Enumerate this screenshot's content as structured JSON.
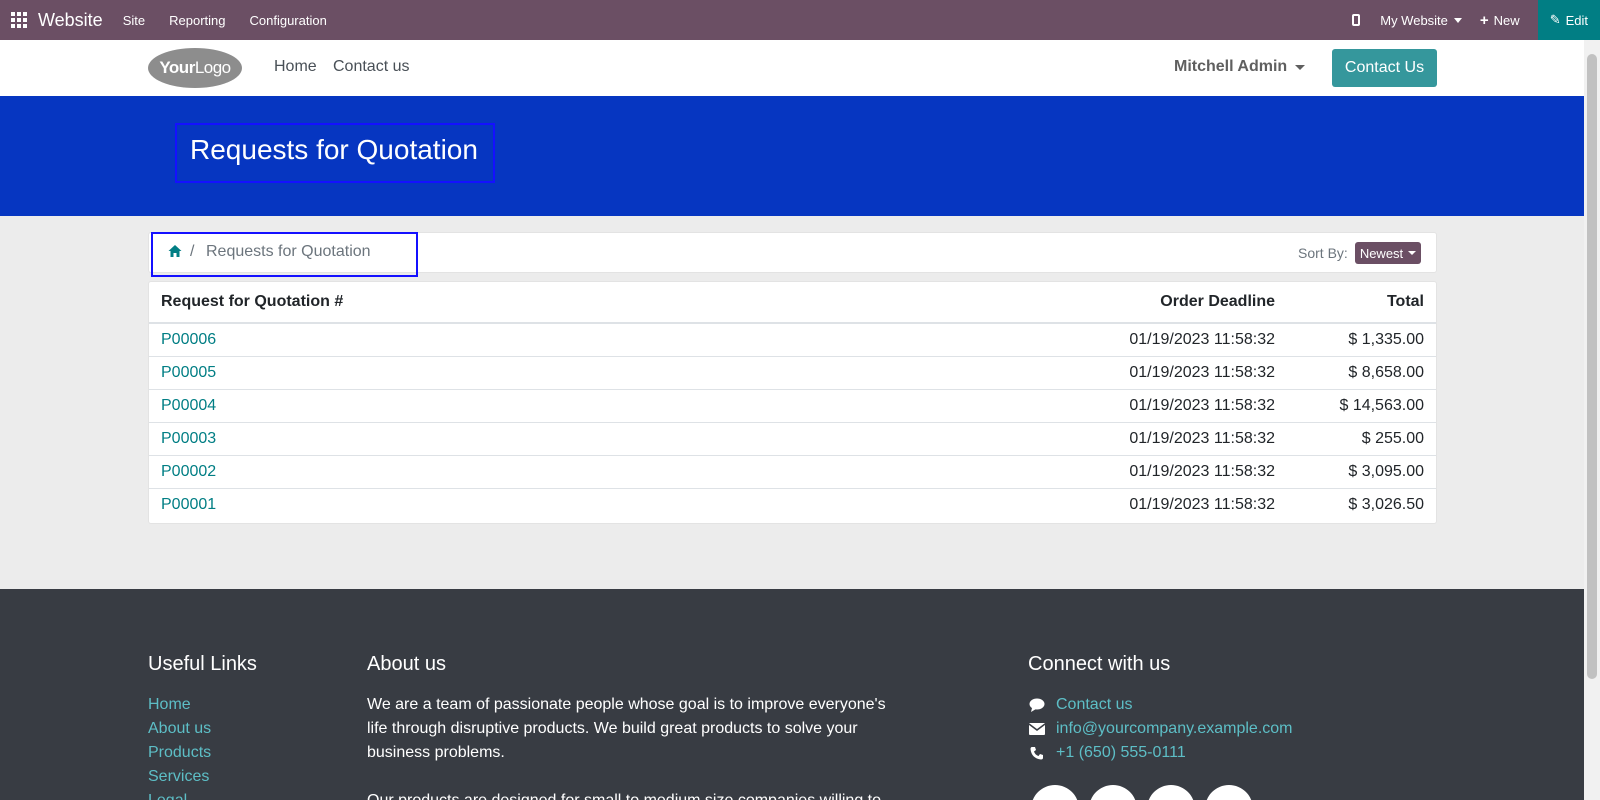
{
  "admin_bar": {
    "app_name": "Website",
    "menu": [
      "Site",
      "Reporting",
      "Configuration"
    ],
    "website_selector": "My Website",
    "new_label": "New",
    "edit_label": "Edit"
  },
  "header": {
    "logo_text_bold": "Your",
    "logo_text": "Logo",
    "nav": [
      "Home",
      "Contact us"
    ],
    "user_name": "Mitchell Admin",
    "cta_label": "Contact Us"
  },
  "banner": {
    "title": "Requests for Quotation"
  },
  "breadcrumb": {
    "separator": "/",
    "current": "Requests for Quotation"
  },
  "sort": {
    "label": "Sort By:",
    "value": "Newest"
  },
  "table": {
    "columns": [
      "Request for Quotation #",
      "Order Deadline",
      "Total"
    ],
    "rows": [
      {
        "ref": "P00006",
        "deadline": "01/19/2023  11:58:32",
        "total": "$ 1,335.00"
      },
      {
        "ref": "P00005",
        "deadline": "01/19/2023  11:58:32",
        "total": "$ 8,658.00"
      },
      {
        "ref": "P00004",
        "deadline": "01/19/2023  11:58:32",
        "total": "$ 14,563.00"
      },
      {
        "ref": "P00003",
        "deadline": "01/19/2023  11:58:32",
        "total": "$ 255.00"
      },
      {
        "ref": "P00002",
        "deadline": "01/19/2023  11:58:32",
        "total": "$ 3,095.00"
      },
      {
        "ref": "P00001",
        "deadline": "01/19/2023  11:58:32",
        "total": "$ 3,026.50"
      }
    ]
  },
  "footer": {
    "useful_links_title": "Useful Links",
    "useful_links": [
      "Home",
      "About us",
      "Products",
      "Services",
      "Legal"
    ],
    "about_title": "About us",
    "about_text": "We are a team of passionate people whose goal is to improve everyone's life through disruptive products. We build great products to solve your business problems.",
    "about_text_2": "Our products are designed for small to medium size companies willing to",
    "connect_title": "Connect with us",
    "contact_link": "Contact us",
    "email": "info@yourcompany.example.com",
    "phone": "+1 (650) 555-0111"
  },
  "colors": {
    "admin_bar": "#6b4f64",
    "edit_button": "#017e84",
    "banner": "#0636c1",
    "link": "#017e84",
    "footer_bg": "#383c43",
    "footer_link": "#5dbec6"
  }
}
